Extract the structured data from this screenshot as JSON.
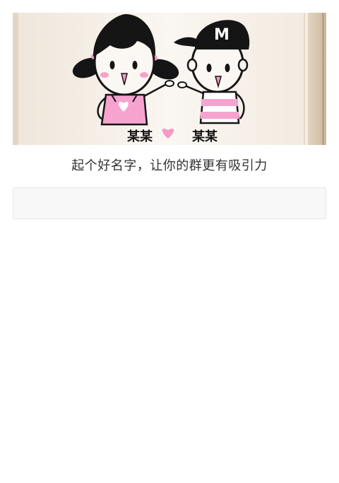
{
  "banner": {
    "caption_left": "某某",
    "caption_right": "某某",
    "cap_letter": "M"
  },
  "prompt": {
    "text": "起个好名字，让你的群更有吸引力"
  },
  "group_name_input": {
    "value": "",
    "placeholder": ""
  }
}
